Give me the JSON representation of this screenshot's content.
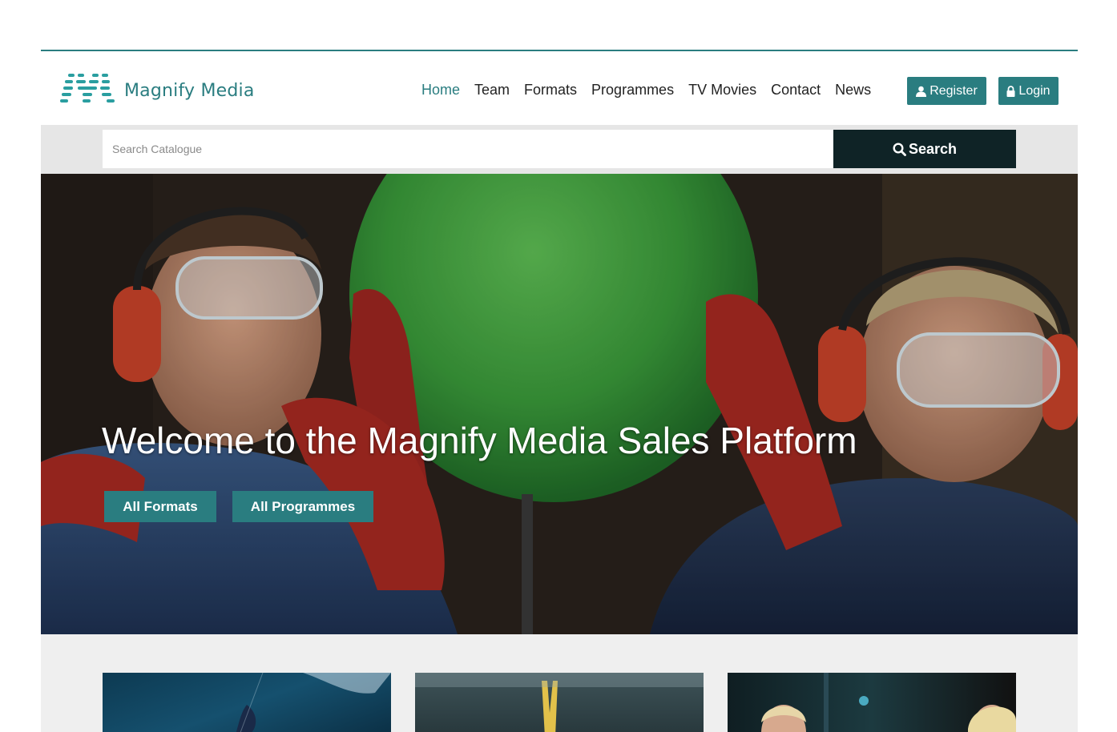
{
  "brand": {
    "name": "Magnify Media",
    "accent": "#2a7d80",
    "dark": "#0f2326"
  },
  "nav": {
    "items": [
      {
        "label": "Home",
        "active": true
      },
      {
        "label": "Team"
      },
      {
        "label": "Formats"
      },
      {
        "label": "Programmes"
      },
      {
        "label": "TV Movies"
      },
      {
        "label": "Contact"
      },
      {
        "label": "News"
      }
    ]
  },
  "header": {
    "register_label": "Register",
    "login_label": "Login"
  },
  "search": {
    "placeholder": "Search Catalogue",
    "button_label": "Search"
  },
  "hero": {
    "title": "Welcome to the Magnify Media Sales Platform",
    "btn_formats": "All Formats",
    "btn_programmes": "All Programmes"
  }
}
